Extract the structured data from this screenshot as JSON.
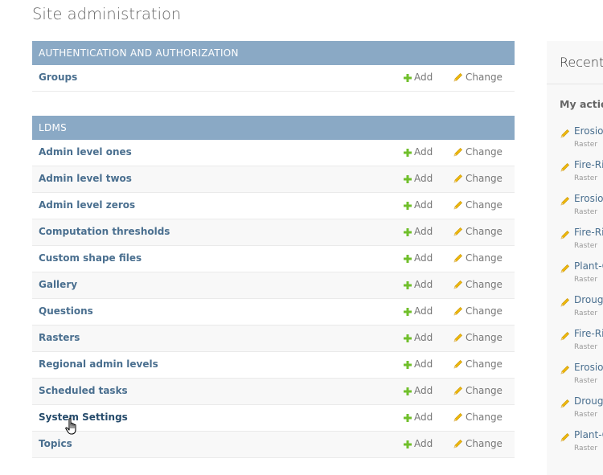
{
  "page": {
    "title": "Site administration"
  },
  "links": {
    "add": "Add",
    "change": "Change"
  },
  "modules": [
    {
      "header": "Authentication and Authorization",
      "rows": [
        "Groups"
      ]
    },
    {
      "header": "LDMS",
      "rows": [
        "Admin level ones",
        "Admin level twos",
        "Admin level zeros",
        "Computation thresholds",
        "Custom shape files",
        "Gallery",
        "Questions",
        "Rasters",
        "Regional admin levels",
        "Scheduled tasks",
        "System Settings",
        "Topics"
      ]
    }
  ],
  "recent": {
    "title": "Recent",
    "subtitle": "My actio",
    "items": [
      {
        "name": "Erosio",
        "type": "Raster"
      },
      {
        "name": "Fire-Ri",
        "type": "Raster"
      },
      {
        "name": "Erosio",
        "type": "Raster"
      },
      {
        "name": "Fire-Ri",
        "type": "Raster"
      },
      {
        "name": "Plant-C",
        "type": "Raster"
      },
      {
        "name": "Droug",
        "type": "Raster"
      },
      {
        "name": "Fire-Ri",
        "type": "Raster"
      },
      {
        "name": "Erosio",
        "type": "Raster"
      },
      {
        "name": "Droug",
        "type": "Raster"
      },
      {
        "name": "Plant-C",
        "type": "Raster"
      }
    ]
  },
  "colors": {
    "header_bg": "#8aa9c5",
    "link": "#4a6f8f",
    "add_icon": "#70bf2b",
    "change_icon": "#efb80b"
  }
}
